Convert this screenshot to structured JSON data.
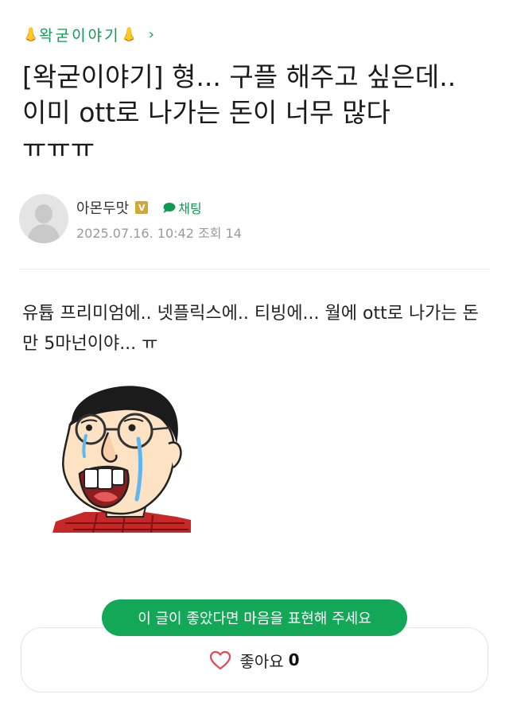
{
  "board": {
    "name": "왁굳이야기",
    "left_emoji": "👃",
    "right_emoji": "👃",
    "chevron": "›"
  },
  "post": {
    "title": "[왁굳이야기] 형... 구플 해주고 싶은데.. 이미 ott로 나가는 돈이 너무 많다 ㅠㅠㅠ",
    "author": "아몬두맛",
    "verified_badge": "V",
    "chat_label": "채팅",
    "date": "2025.07.16. 10:42",
    "views_label": "조회",
    "views": "14",
    "body": "유튭 프리미엄에.. 넷플릭스에.. 티빙에... 월에 ott로 나가는 돈만 5마넌이야... ㅠ"
  },
  "like_prompt": "이 글이 좋았다면 마음을 표현해 주세요",
  "like": {
    "label": "좋아요",
    "count": "0"
  },
  "colors": {
    "accent": "#0f9a54",
    "banner": "#13a858"
  },
  "icons": [
    "nose-emoji-icon",
    "chevron-right-icon",
    "verified-badge-icon",
    "chat-bubble-icon",
    "heart-icon",
    "default-avatar-icon"
  ]
}
